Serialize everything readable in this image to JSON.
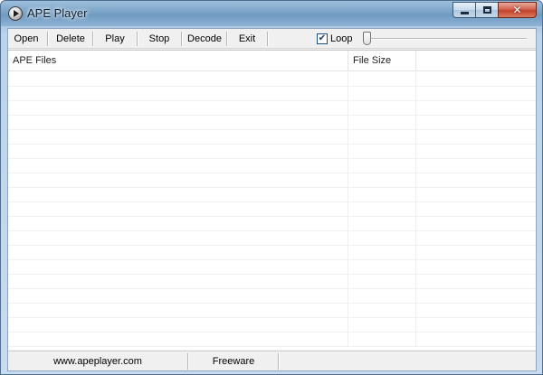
{
  "window": {
    "title": "APE Player"
  },
  "toolbar": {
    "open_label": "Open",
    "delete_label": "Delete",
    "play_label": "Play",
    "stop_label": "Stop",
    "decode_label": "Decode",
    "exit_label": "Exit",
    "loop_label": "Loop",
    "loop_checked": true,
    "volume_fraction": 0.0
  },
  "file_list": {
    "columns": [
      "APE Files",
      "File Size"
    ],
    "rows": []
  },
  "statusbar": {
    "website": "www.apeplayer.com",
    "license": "Freeware"
  },
  "icons": {
    "app": "play-disc-icon",
    "check": "checkmark-icon"
  }
}
